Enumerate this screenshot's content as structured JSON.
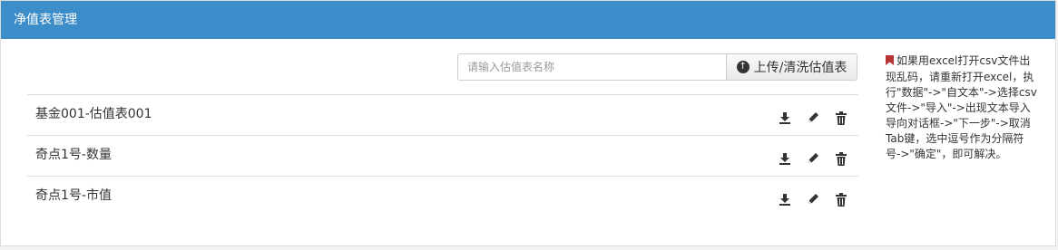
{
  "panel": {
    "title": "净值表管理"
  },
  "search": {
    "placeholder": "请输入估值表名称",
    "value": ""
  },
  "upload_button": {
    "label": "上传/清洗估值表",
    "icon": "circle-arrow-up-icon"
  },
  "items": [
    {
      "name": "基金001-估值表001"
    },
    {
      "name": "奇点1号-数量"
    },
    {
      "name": "奇点1号-市值"
    }
  ],
  "row_actions": {
    "download_icon": "download-icon",
    "edit_icon": "pencil-icon",
    "delete_icon": "trash-icon"
  },
  "note": {
    "icon": "bookmark-icon",
    "text": "如果用excel打开csv文件出现乱码，请重新打开excel，执行\"数据\"->\"自文本\"->选择csv文件->\"导入\"->出现文本导入导向对话框->\"下一步\"->取消Tab键，选中逗号作为分隔符号->\"确定\"，即可解决。"
  },
  "colors": {
    "header_bg": "#3c8dca",
    "bookmark": "#b93535"
  }
}
